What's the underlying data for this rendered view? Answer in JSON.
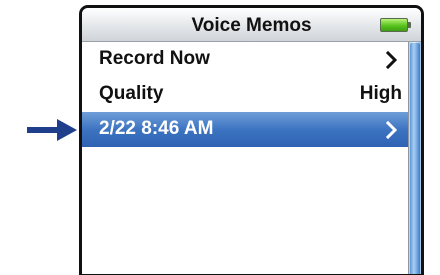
{
  "header": {
    "title": "Voice Memos",
    "battery_icon": "battery-full-icon",
    "battery_color": "#58c41e"
  },
  "menu": {
    "items": [
      {
        "label": "Record Now",
        "value": "",
        "icon": "chevron-right-icon",
        "selected": false
      },
      {
        "label": "Quality",
        "value": "High",
        "icon": "",
        "selected": false
      },
      {
        "label": "2/22 8:46 AM",
        "value": "",
        "icon": "chevron-right-icon",
        "selected": true
      }
    ]
  },
  "pointer": {
    "icon": "arrow-right-icon",
    "color": "#1f3f8c"
  },
  "colors": {
    "selection": "#3d74c2",
    "scrollbar": "#5f98d6"
  }
}
